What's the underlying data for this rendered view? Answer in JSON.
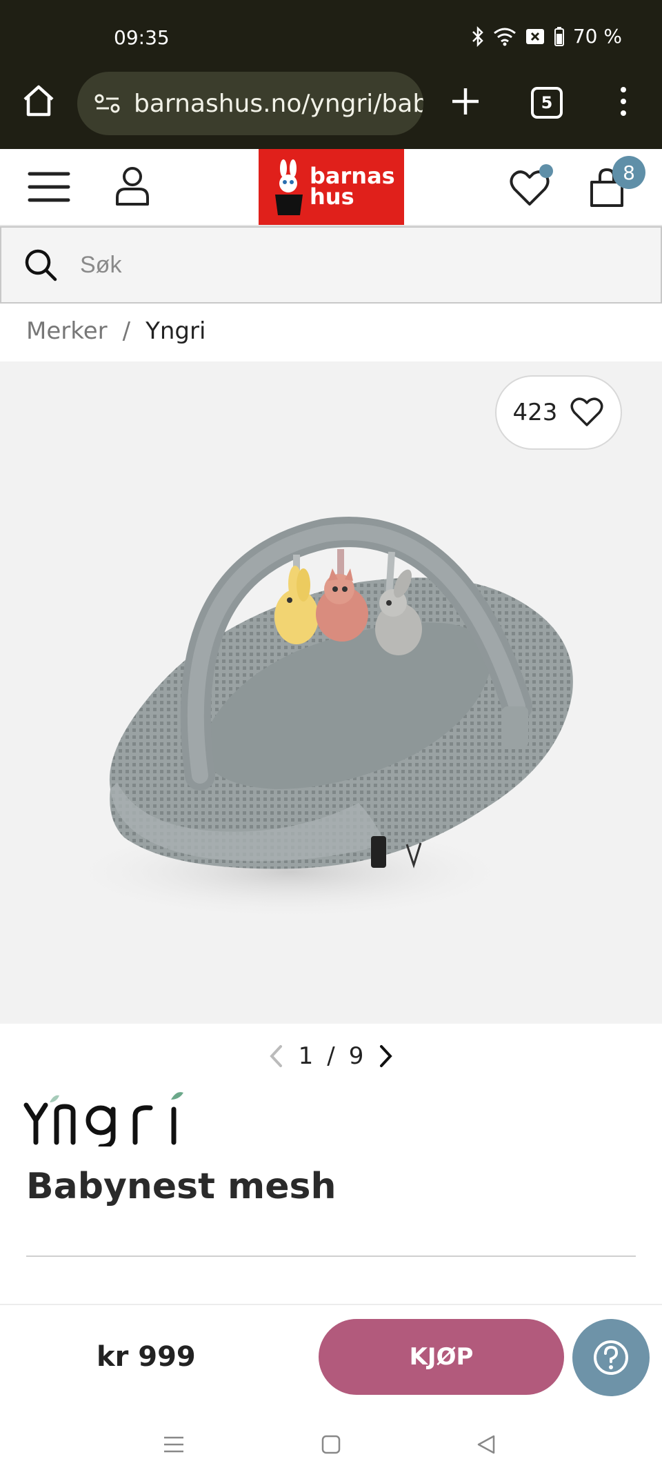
{
  "status_bar": {
    "time": "09:35",
    "battery": "70 %"
  },
  "browser": {
    "url": "barnashus.no/yngri/baby",
    "tab_count": "5"
  },
  "header": {
    "logo_line1": "barnas",
    "logo_line2": "hus",
    "cart_count": "8"
  },
  "search": {
    "placeholder": "Søk"
  },
  "breadcrumb": {
    "items": [
      "Merker",
      "Yngri"
    ],
    "separator": "/"
  },
  "gallery": {
    "favorite_count": "423",
    "current": "1",
    "separator": "/",
    "total": "9"
  },
  "product": {
    "brand": "Yngri",
    "title": "Babynest mesh"
  },
  "buybar": {
    "price": "kr 999",
    "buy_label": "KJØP"
  },
  "colors": {
    "brand_red": "#e0201b",
    "buy_button": "#b25a7c",
    "accent_blue": "#5f8fa8",
    "chrome_bg": "#1f1f14"
  },
  "icons": [
    "home-icon",
    "site-settings-icon",
    "plus-icon",
    "tabs-icon",
    "more-icon",
    "hamburger-icon",
    "user-icon",
    "heart-icon",
    "cart-icon",
    "search-icon",
    "chevron-left-icon",
    "chevron-right-icon",
    "help-icon"
  ]
}
